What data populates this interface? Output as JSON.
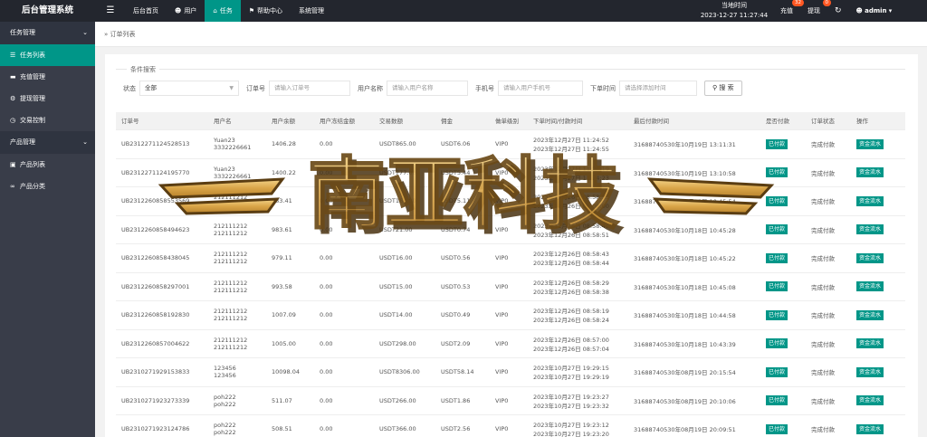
{
  "app": {
    "title": "后台管理系统"
  },
  "topnav": [
    {
      "label": "后台首页",
      "icon": "",
      "active": false
    },
    {
      "label": "用户",
      "icon": "user-icon",
      "active": false
    },
    {
      "label": "任务",
      "icon": "home-icon",
      "active": true
    },
    {
      "label": "帮助中心",
      "icon": "flag-icon",
      "active": false
    },
    {
      "label": "系统管理",
      "icon": "",
      "active": false
    }
  ],
  "clock": {
    "label": "当地时间",
    "value": "2023-12-27 11:27:44"
  },
  "topright": {
    "recharge": {
      "label": "充值",
      "count": "32"
    },
    "withdraw": {
      "label": "提现",
      "count": "0"
    },
    "user": "admin"
  },
  "sidebar": {
    "groups": [
      {
        "label": "任务管理",
        "items": [
          {
            "label": "任务列表",
            "icon": "list-icon",
            "active": true
          },
          {
            "label": "充值管理",
            "icon": "comment-icon",
            "active": false
          },
          {
            "label": "提现管理",
            "icon": "wrench-icon",
            "active": false
          },
          {
            "label": "交易控制",
            "icon": "dashboard-icon",
            "active": false
          }
        ]
      },
      {
        "label": "产品管理",
        "items": [
          {
            "label": "产品列表",
            "icon": "cart-icon",
            "active": false
          },
          {
            "label": "产品分类",
            "icon": "link-icon",
            "active": false
          }
        ]
      }
    ]
  },
  "breadcrumb": {
    "sep": "»",
    "label": "订单列表"
  },
  "search": {
    "legend": "条件搜索",
    "status_label": "状态",
    "status_value": "全部",
    "order_label": "订单号",
    "order_placeholder": "请输入订单号",
    "username_label": "用户名称",
    "username_placeholder": "请输入用户名称",
    "phone_label": "手机号",
    "phone_placeholder": "请输入用户手机号",
    "time_label": "下单时间",
    "time_placeholder": "请选择添加时间",
    "button": "搜 索"
  },
  "table": {
    "columns": [
      "订单号",
      "用户名",
      "用户余额",
      "用户冻结金额",
      "交易数额",
      "佣金",
      "做单级别",
      "下单时间/付款时间",
      "最后付款时间",
      "是否付款",
      "订单状态",
      "操作"
    ],
    "rows": [
      {
        "order": "UB2312271124528513",
        "user1": "Yuan23",
        "user2": "3332226661",
        "balance": "1406.28",
        "frozen": "0.00",
        "amount": "USDT865.00",
        "comm": "USDT6.06",
        "level": "VIP0",
        "t1": "2023年12月27日 11:24:52",
        "t2": "2023年12月27日 11:24:55",
        "last": "31688740530年10月19日 13:11:31",
        "paid": "已付款",
        "status": "完成付款",
        "op": "资金流水"
      },
      {
        "order": "UB2312271124195770",
        "user1": "Yuan23",
        "user2": "3332226661",
        "balance": "1400.22",
        "frozen": "0.00",
        "amount": "USDT777.00",
        "comm": "USDT5.44",
        "level": "VIP0",
        "t1": "2023年12月27日 11:24:19",
        "t2": "2023年12月27日 11:24:23",
        "last": "31688740530年10月19日 13:10:58",
        "paid": "已付款",
        "status": "完成付款",
        "op": "资金流水"
      },
      {
        "order": "UB2312260858553569",
        "user1": "212111212",
        "user2": "212111212",
        "balance": "983.41",
        "frozen": "0.00",
        "amount": "USDT160.00",
        "comm": "USDT5.11",
        "level": "VIP0",
        "t1": "2023年12月26日 08:58:55",
        "t2": "2023年12月26日 09:00:00",
        "last": "31688740530年10月18日 10:45:54",
        "paid": "已付款",
        "status": "完成付款",
        "op": "资金流水"
      },
      {
        "order": "UB2312260858494623",
        "user1": "212111212",
        "user2": "212111212",
        "balance": "983.61",
        "frozen": "0.00",
        "amount": "USDT21.00",
        "comm": "USDT0.74",
        "level": "VIP0",
        "t1": "2023年12月26日 08:58:49",
        "t2": "2023年12月26日 08:58:51",
        "last": "31688740530年10月18日 10:45:28",
        "paid": "已付款",
        "status": "完成付款",
        "op": "资金流水"
      },
      {
        "order": "UB2312260858438045",
        "user1": "212111212",
        "user2": "212111212",
        "balance": "979.11",
        "frozen": "0.00",
        "amount": "USDT16.00",
        "comm": "USDT0.56",
        "level": "VIP0",
        "t1": "2023年12月26日 08:58:43",
        "t2": "2023年12月26日 08:58:44",
        "last": "31688740530年10月18日 10:45:22",
        "paid": "已付款",
        "status": "完成付款",
        "op": "资金流水"
      },
      {
        "order": "UB2312260858297001",
        "user1": "212111212",
        "user2": "212111212",
        "balance": "993.58",
        "frozen": "0.00",
        "amount": "USDT15.00",
        "comm": "USDT0.53",
        "level": "VIP0",
        "t1": "2023年12月26日 08:58:29",
        "t2": "2023年12月26日 08:58:38",
        "last": "31688740530年10月18日 10:45:08",
        "paid": "已付款",
        "status": "完成付款",
        "op": "资金流水"
      },
      {
        "order": "UB2312260858192830",
        "user1": "212111212",
        "user2": "212111212",
        "balance": "1007.09",
        "frozen": "0.00",
        "amount": "USDT14.00",
        "comm": "USDT0.49",
        "level": "VIP0",
        "t1": "2023年12月26日 08:58:19",
        "t2": "2023年12月26日 08:58:24",
        "last": "31688740530年10月18日 10:44:58",
        "paid": "已付款",
        "status": "完成付款",
        "op": "资金流水"
      },
      {
        "order": "UB2312260857004622",
        "user1": "212111212",
        "user2": "212111212",
        "balance": "1005.00",
        "frozen": "0.00",
        "amount": "USDT298.00",
        "comm": "USDT2.09",
        "level": "VIP0",
        "t1": "2023年12月26日 08:57:00",
        "t2": "2023年12月26日 08:57:04",
        "last": "31688740530年10月18日 10:43:39",
        "paid": "已付款",
        "status": "完成付款",
        "op": "资金流水"
      },
      {
        "order": "UB2310271929153833",
        "user1": "123456",
        "user2": "123456",
        "balance": "10098.04",
        "frozen": "0.00",
        "amount": "USDT8306.00",
        "comm": "USDT58.14",
        "level": "VIP0",
        "t1": "2023年10月27日 19:29:15",
        "t2": "2023年10月27日 19:29:19",
        "last": "31688740530年08月19日 20:15:54",
        "paid": "已付款",
        "status": "完成付款",
        "op": "资金流水"
      },
      {
        "order": "UB2310271923273339",
        "user1": "poh222",
        "user2": "poh222",
        "balance": "511.07",
        "frozen": "0.00",
        "amount": "USDT266.00",
        "comm": "USDT1.86",
        "level": "VIP0",
        "t1": "2023年10月27日 19:23:27",
        "t2": "2023年10月27日 19:23:32",
        "last": "31688740530年08月19日 20:10:06",
        "paid": "已付款",
        "status": "完成付款",
        "op": "资金流水"
      },
      {
        "order": "UB2310271923124786",
        "user1": "poh222",
        "user2": "poh222",
        "balance": "508.51",
        "frozen": "0.00",
        "amount": "USDT366.00",
        "comm": "USDT2.56",
        "level": "VIP0",
        "t1": "2023年10月27日 19:23:12",
        "t2": "2023年10月27日 19:23:20",
        "last": "31688740530年08月19日 20:09:51",
        "paid": "已付款",
        "status": "完成付款",
        "op": "资金流水"
      }
    ]
  },
  "watermark": {
    "text": "南亚科技"
  },
  "colors": {
    "accent": "#009688",
    "topbar": "#23262e",
    "sidebar": "#393d49",
    "badge": "#ff5722",
    "watermark_gold": "#c99a3c"
  }
}
